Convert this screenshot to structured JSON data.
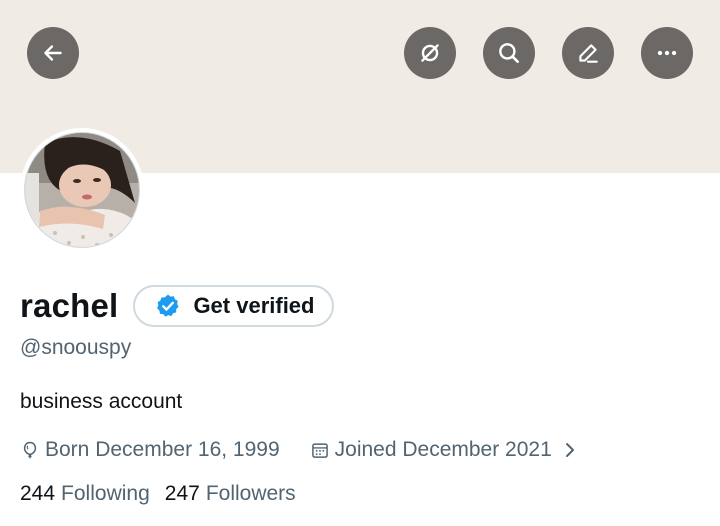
{
  "banner": {
    "color": "#f1ebe5"
  },
  "header": {
    "buttons": [
      {
        "icon": "back-arrow-icon"
      },
      {
        "icon": "grok-icon"
      },
      {
        "icon": "search-icon"
      },
      {
        "icon": "edit-icon"
      },
      {
        "icon": "more-icon"
      }
    ]
  },
  "profile": {
    "display_name": "rachel",
    "verify_label": "Get verified",
    "handle": "@snoouspy",
    "bio": "business account",
    "birthday": "Born December 16, 1999",
    "joined": "Joined December 2021",
    "following_count": "244",
    "following_label": "Following",
    "followers_count": "247",
    "followers_label": "Followers"
  },
  "colors": {
    "verified_blue": "#1d9bf0",
    "secondary_text": "#536471",
    "button_bg": "#6b6866"
  }
}
